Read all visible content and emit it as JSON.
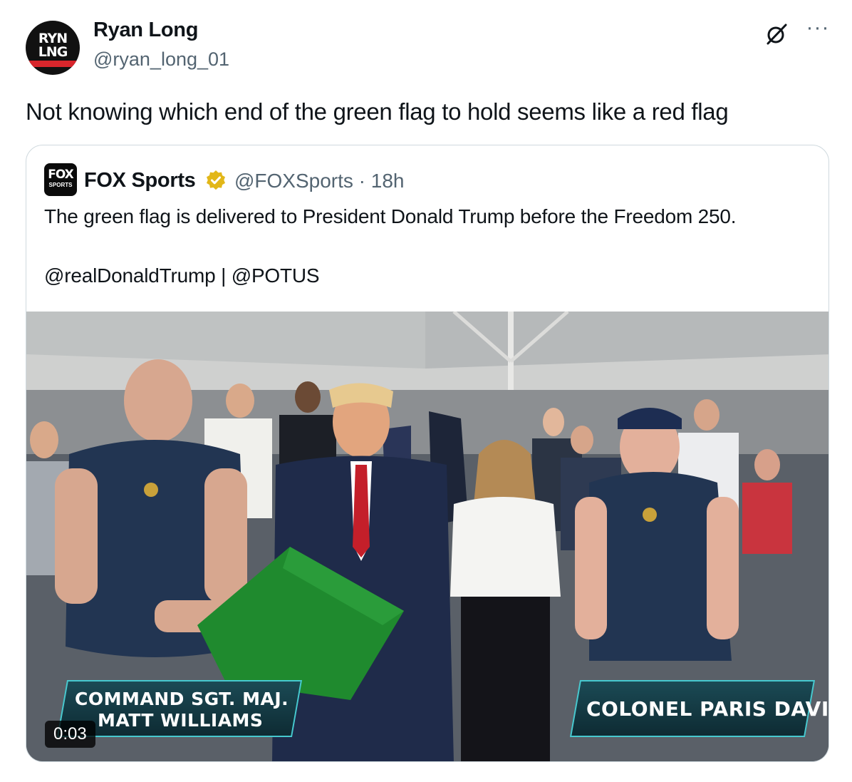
{
  "tweet": {
    "avatar_text_1": "RYN",
    "avatar_text_2": "LNG",
    "author_name": "Ryan Long",
    "author_handle": "@ryan_long_01",
    "text": "Not knowing which end of the green flag to hold seems like a red flag",
    "icons": {
      "grok": "grok-slash-icon",
      "more": "more-dots-icon"
    },
    "more_glyph": "···"
  },
  "quote": {
    "avatar_text": "FOX",
    "avatar_subtext": "SPORTS",
    "author_name": "FOX Sports",
    "verified_icon": "verified-badge-icon",
    "verified_color": "#e2b719",
    "meta": "@FOXSports · 18h",
    "text": "The green flag is delivered to President Donald Trump before the Freedom 250.",
    "tags": "@realDonaldTrump | @POTUS",
    "video": {
      "caption_left_line1": "COMMAND SGT. MAJ.",
      "caption_left_line2": "MATT WILLIAMS",
      "caption_right": "COLONEL PARIS DAVIS",
      "timestamp": "0:03"
    }
  },
  "colors": {
    "text": "#0f1419",
    "secondary": "#536471",
    "border": "#cfd9de",
    "flag_green": "#1f8a2e",
    "caption_teal": "#46c9cf"
  }
}
